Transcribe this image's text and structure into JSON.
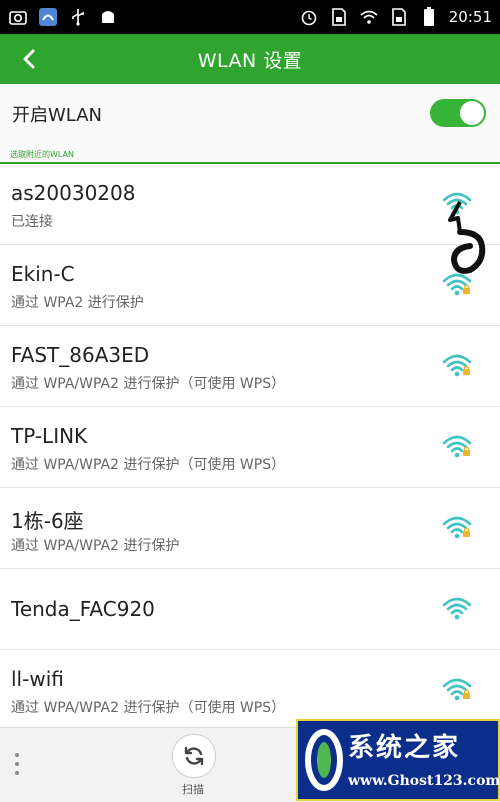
{
  "status_bar": {
    "time": "20:51",
    "left_icons": [
      "camera-icon",
      "app-icon",
      "usb-icon",
      "android-icon"
    ],
    "right_icons": [
      "alarm-icon",
      "sim-icon",
      "wifi-icon",
      "sim-icon",
      "battery-icon"
    ]
  },
  "header": {
    "title": "WLAN 设置"
  },
  "wlan_toggle": {
    "label": "开启WLAN",
    "on": true
  },
  "section": {
    "label": "选取附近的WLAN"
  },
  "networks": [
    {
      "name": "as20030208",
      "status": "已连接",
      "locked": false
    },
    {
      "name": "Ekin-C",
      "status": "通过 WPA2 进行保护",
      "locked": true
    },
    {
      "name": "FAST_86A3ED",
      "status": "通过 WPA/WPA2 进行保护（可使用 WPS）",
      "locked": true
    },
    {
      "name": "TP-LINK",
      "status": "通过 WPA/WPA2 进行保护（可使用 WPS）",
      "locked": true
    },
    {
      "name": "1栋-6座",
      "status": "通过 WPA/WPA2 进行保护",
      "locked": true
    },
    {
      "name": "Tenda_FAC920",
      "status": "",
      "locked": false
    },
    {
      "name": "ll-wifi",
      "status": "通过 WPA/WPA2 进行保护（可使用 WPS）",
      "locked": true
    }
  ],
  "bottom": {
    "scan_label": "扫描"
  },
  "watermark": {
    "title": "系统之家",
    "url": "www.Ghost123.com"
  },
  "colors": {
    "accent": "#2fa52f",
    "wifi": "#3ec3c0",
    "lock": "#f0b429"
  }
}
